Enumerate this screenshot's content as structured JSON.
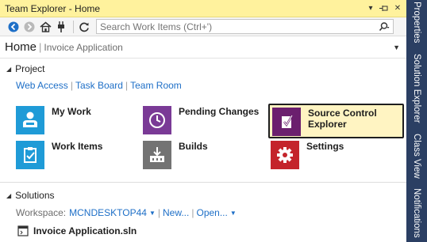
{
  "window": {
    "title": "Team Explorer - Home"
  },
  "title_buttons": {
    "dropdown": "▾",
    "pin": "⊣",
    "close": "✕"
  },
  "search": {
    "placeholder": "Search Work Items (Ctrl+')"
  },
  "header": {
    "home": "Home",
    "separator": "|",
    "project": "Invoice Application"
  },
  "project_section": {
    "heading": "Project",
    "links": [
      "Web Access",
      "Task Board",
      "Team Room"
    ]
  },
  "tiles": {
    "my_work": {
      "label": "My Work",
      "color": "#1f9bd7"
    },
    "pending_changes": {
      "label": "Pending Changes",
      "color": "#7a3a96"
    },
    "source_control": {
      "label1": "Source Control",
      "label2": "Explorer",
      "color": "#6b1f6e"
    },
    "work_items": {
      "label": "Work Items",
      "color": "#1f9bd7"
    },
    "builds": {
      "label": "Builds",
      "color": "#737373"
    },
    "settings": {
      "label": "Settings",
      "color": "#c4242b"
    }
  },
  "solutions_section": {
    "heading": "Solutions",
    "workspace_label": "Workspace:",
    "workspace_name": "MCNDESKTOP44",
    "new_link": "New...",
    "open_link": "Open...",
    "solution_file": "Invoice Application.sln"
  },
  "right_dock": {
    "tabs": [
      "Properties",
      "Solution Explorer",
      "Class View",
      "Notifications"
    ]
  },
  "colors": {
    "title_bg": "#fff29d",
    "dock_bg": "#2b3f63",
    "link": "#1e6fc7",
    "selected_tile_bg": "#fff4c2"
  }
}
